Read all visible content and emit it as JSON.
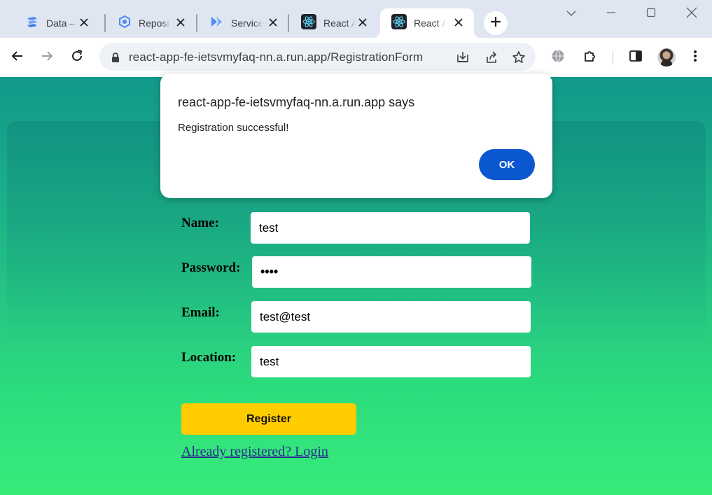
{
  "browser": {
    "tabs": [
      {
        "title": "Data – ",
        "icon": "datastream-icon"
      },
      {
        "title": "Reposi",
        "icon": "artifact-registry-icon"
      },
      {
        "title": "Service",
        "icon": "cloud-run-icon"
      },
      {
        "title": "React A",
        "icon": "react-icon"
      },
      {
        "title": "React A",
        "icon": "react-icon",
        "active": true
      }
    ],
    "url": "react-app-fe-ietsvmyfaq-nn.a.run.app/RegistrationForm",
    "accent_color": "#0b57d0"
  },
  "dialog": {
    "title": "react-app-fe-ietsvmyfaq-nn.a.run.app says",
    "message": "Registration successful!",
    "ok_label": "OK"
  },
  "form": {
    "name_label": "Name:",
    "name_value": "test",
    "password_label": "Password:",
    "password_value": "••••",
    "email_label": "Email:",
    "email_value": "test@test",
    "location_label": "Location:",
    "location_value": "test",
    "register_label": "Register",
    "login_link": "Already registered? Login"
  }
}
